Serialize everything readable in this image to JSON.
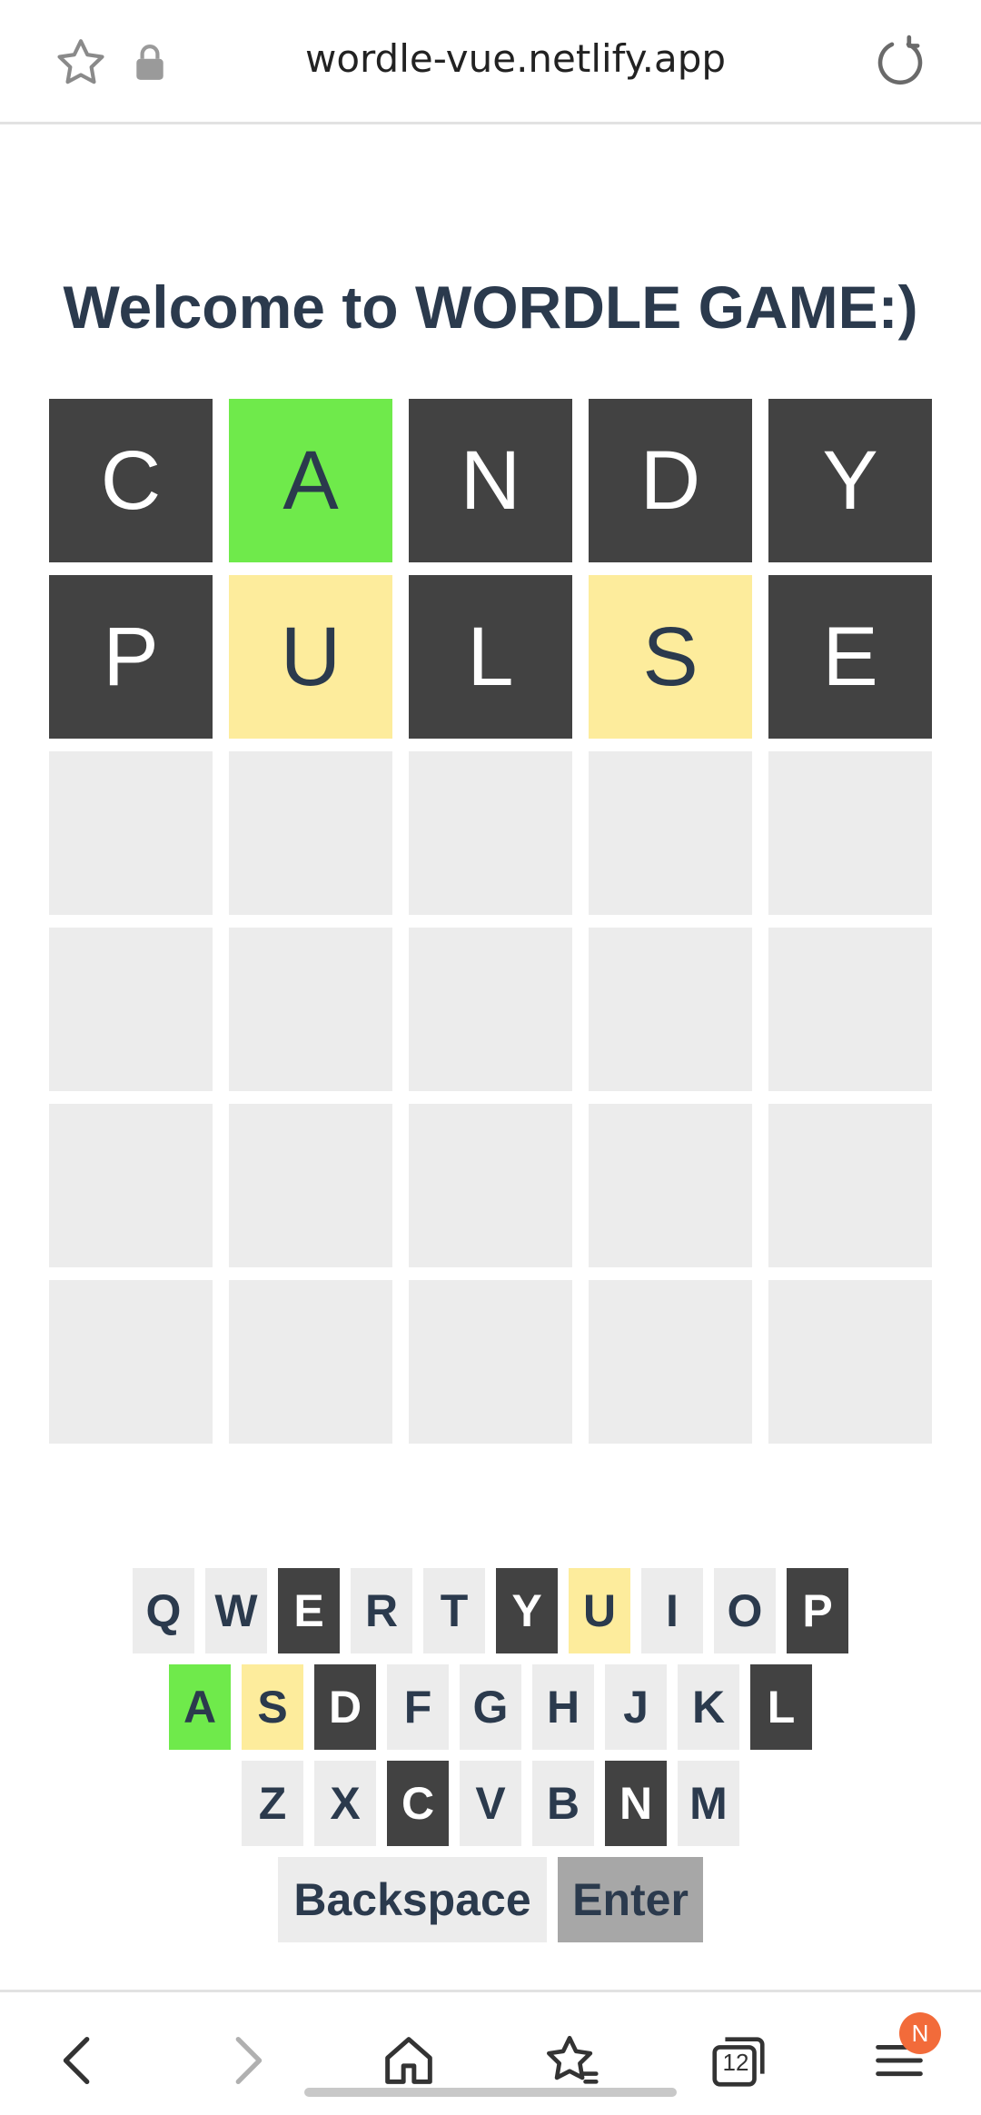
{
  "browser": {
    "url": "wordle-vue.netlify.app",
    "tab_count": "12",
    "menu_badge": "N"
  },
  "title": "Welcome to WORDLE GAME:)",
  "board": [
    [
      {
        "l": "C",
        "s": "absent"
      },
      {
        "l": "A",
        "s": "correct"
      },
      {
        "l": "N",
        "s": "absent"
      },
      {
        "l": "D",
        "s": "absent"
      },
      {
        "l": "Y",
        "s": "absent"
      }
    ],
    [
      {
        "l": "P",
        "s": "absent"
      },
      {
        "l": "U",
        "s": "present"
      },
      {
        "l": "L",
        "s": "absent"
      },
      {
        "l": "S",
        "s": "present"
      },
      {
        "l": "E",
        "s": "absent"
      }
    ],
    [
      {
        "l": "",
        "s": "empty"
      },
      {
        "l": "",
        "s": "empty"
      },
      {
        "l": "",
        "s": "empty"
      },
      {
        "l": "",
        "s": "empty"
      },
      {
        "l": "",
        "s": "empty"
      }
    ],
    [
      {
        "l": "",
        "s": "empty"
      },
      {
        "l": "",
        "s": "empty"
      },
      {
        "l": "",
        "s": "empty"
      },
      {
        "l": "",
        "s": "empty"
      },
      {
        "l": "",
        "s": "empty"
      }
    ],
    [
      {
        "l": "",
        "s": "empty"
      },
      {
        "l": "",
        "s": "empty"
      },
      {
        "l": "",
        "s": "empty"
      },
      {
        "l": "",
        "s": "empty"
      },
      {
        "l": "",
        "s": "empty"
      }
    ],
    [
      {
        "l": "",
        "s": "empty"
      },
      {
        "l": "",
        "s": "empty"
      },
      {
        "l": "",
        "s": "empty"
      },
      {
        "l": "",
        "s": "empty"
      },
      {
        "l": "",
        "s": "empty"
      }
    ]
  ],
  "keyboard": [
    [
      {
        "k": "Q",
        "s": ""
      },
      {
        "k": "W",
        "s": ""
      },
      {
        "k": "E",
        "s": "absent"
      },
      {
        "k": "R",
        "s": ""
      },
      {
        "k": "T",
        "s": ""
      },
      {
        "k": "Y",
        "s": "absent"
      },
      {
        "k": "U",
        "s": "present"
      },
      {
        "k": "I",
        "s": ""
      },
      {
        "k": "O",
        "s": ""
      },
      {
        "k": "P",
        "s": "absent"
      }
    ],
    [
      {
        "k": "A",
        "s": "correct"
      },
      {
        "k": "S",
        "s": "present"
      },
      {
        "k": "D",
        "s": "absent"
      },
      {
        "k": "F",
        "s": ""
      },
      {
        "k": "G",
        "s": ""
      },
      {
        "k": "H",
        "s": ""
      },
      {
        "k": "J",
        "s": ""
      },
      {
        "k": "K",
        "s": ""
      },
      {
        "k": "L",
        "s": "absent"
      }
    ],
    [
      {
        "k": "Z",
        "s": ""
      },
      {
        "k": "X",
        "s": ""
      },
      {
        "k": "C",
        "s": "absent"
      },
      {
        "k": "V",
        "s": ""
      },
      {
        "k": "B",
        "s": ""
      },
      {
        "k": "N",
        "s": "absent"
      },
      {
        "k": "M",
        "s": ""
      }
    ]
  ],
  "keys": {
    "backspace": "Backspace",
    "enter": "Enter"
  },
  "colors": {
    "correct": "#6fea4b",
    "present": "#fdec9c",
    "absent": "#424242",
    "empty": "#ececec",
    "enter": "#a7a7a7",
    "text": "#2b3a4d"
  }
}
